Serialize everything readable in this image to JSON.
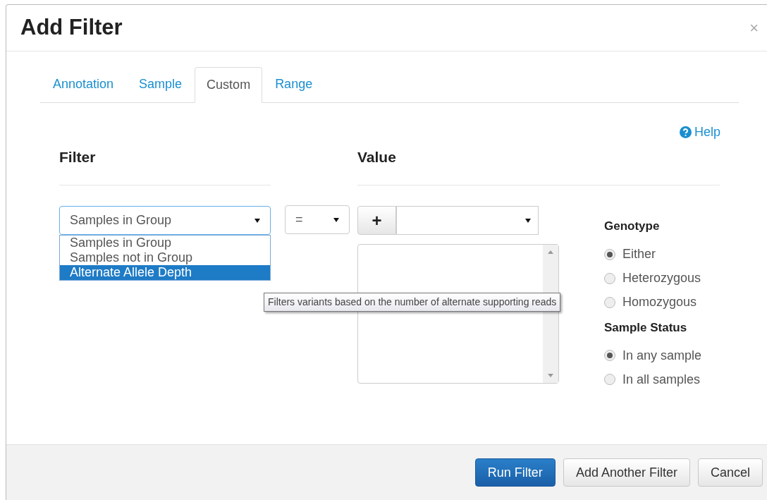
{
  "dialog": {
    "title": "Add Filter",
    "close": "×"
  },
  "tabs": [
    {
      "label": "Annotation",
      "selected": false
    },
    {
      "label": "Sample",
      "selected": false
    },
    {
      "label": "Custom",
      "selected": true
    },
    {
      "label": "Range",
      "selected": false
    }
  ],
  "help": "Help",
  "filter": {
    "heading": "Filter",
    "select_value": "Samples in Group",
    "options": [
      {
        "label": "Samples in Group",
        "selected": false
      },
      {
        "label": "Samples not in Group",
        "selected": false
      },
      {
        "label": "Alternate Allele Depth",
        "selected": true
      }
    ]
  },
  "operator": {
    "value": "="
  },
  "value": {
    "heading": "Value",
    "add": "+"
  },
  "tooltip": "Filters variants based on the number of alternate supporting reads",
  "groups": [
    {
      "title": "Genotype",
      "options": [
        {
          "label": "Either",
          "selected": true
        },
        {
          "label": "Heterozygous",
          "selected": false
        },
        {
          "label": "Homozygous",
          "selected": false
        }
      ]
    },
    {
      "title": "Sample Status",
      "options": [
        {
          "label": "In any sample",
          "selected": true
        },
        {
          "label": "In all samples",
          "selected": false
        }
      ]
    }
  ],
  "buttons": [
    {
      "label": "Run Filter",
      "kind": "primary"
    },
    {
      "label": "Add Another Filter",
      "kind": "default"
    },
    {
      "label": "Cancel",
      "kind": "default"
    }
  ]
}
